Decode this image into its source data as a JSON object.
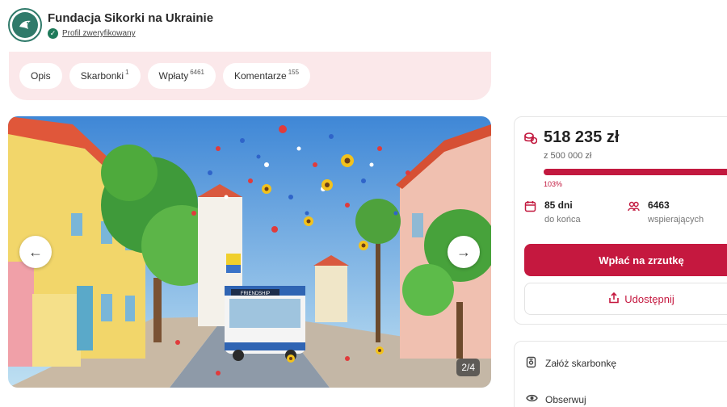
{
  "organization": {
    "name": "Fundacja Sikorki na Ukrainie",
    "verified_label": "Profil zweryfikowany"
  },
  "tabs": [
    {
      "label": "Opis",
      "count": ""
    },
    {
      "label": "Skarbonki",
      "count": "1"
    },
    {
      "label": "Wpłaty",
      "count": "6461"
    },
    {
      "label": "Komentarze",
      "count": "155"
    }
  ],
  "gallery": {
    "counter": "2/4",
    "prev_icon": "arrow-left-icon",
    "next_icon": "arrow-right-icon",
    "bus_sign": "FRIENDSHIP"
  },
  "fundraiser": {
    "amount": "518 235 zł",
    "goal": "z 500 000 zł",
    "percent_label": "103%",
    "progress_fraction": 1.0,
    "days_value": "85 dni",
    "days_label": "do końca",
    "backers_value": "6463",
    "backers_label": "wspierających",
    "donate_label": "Wpłać na zrzutkę",
    "share_label": "Udostępnij",
    "accent_color": "#c5183f"
  },
  "side_actions": {
    "create_piggy_label": "Załóż skarbonkę",
    "watch_label": "Obserwuj"
  }
}
